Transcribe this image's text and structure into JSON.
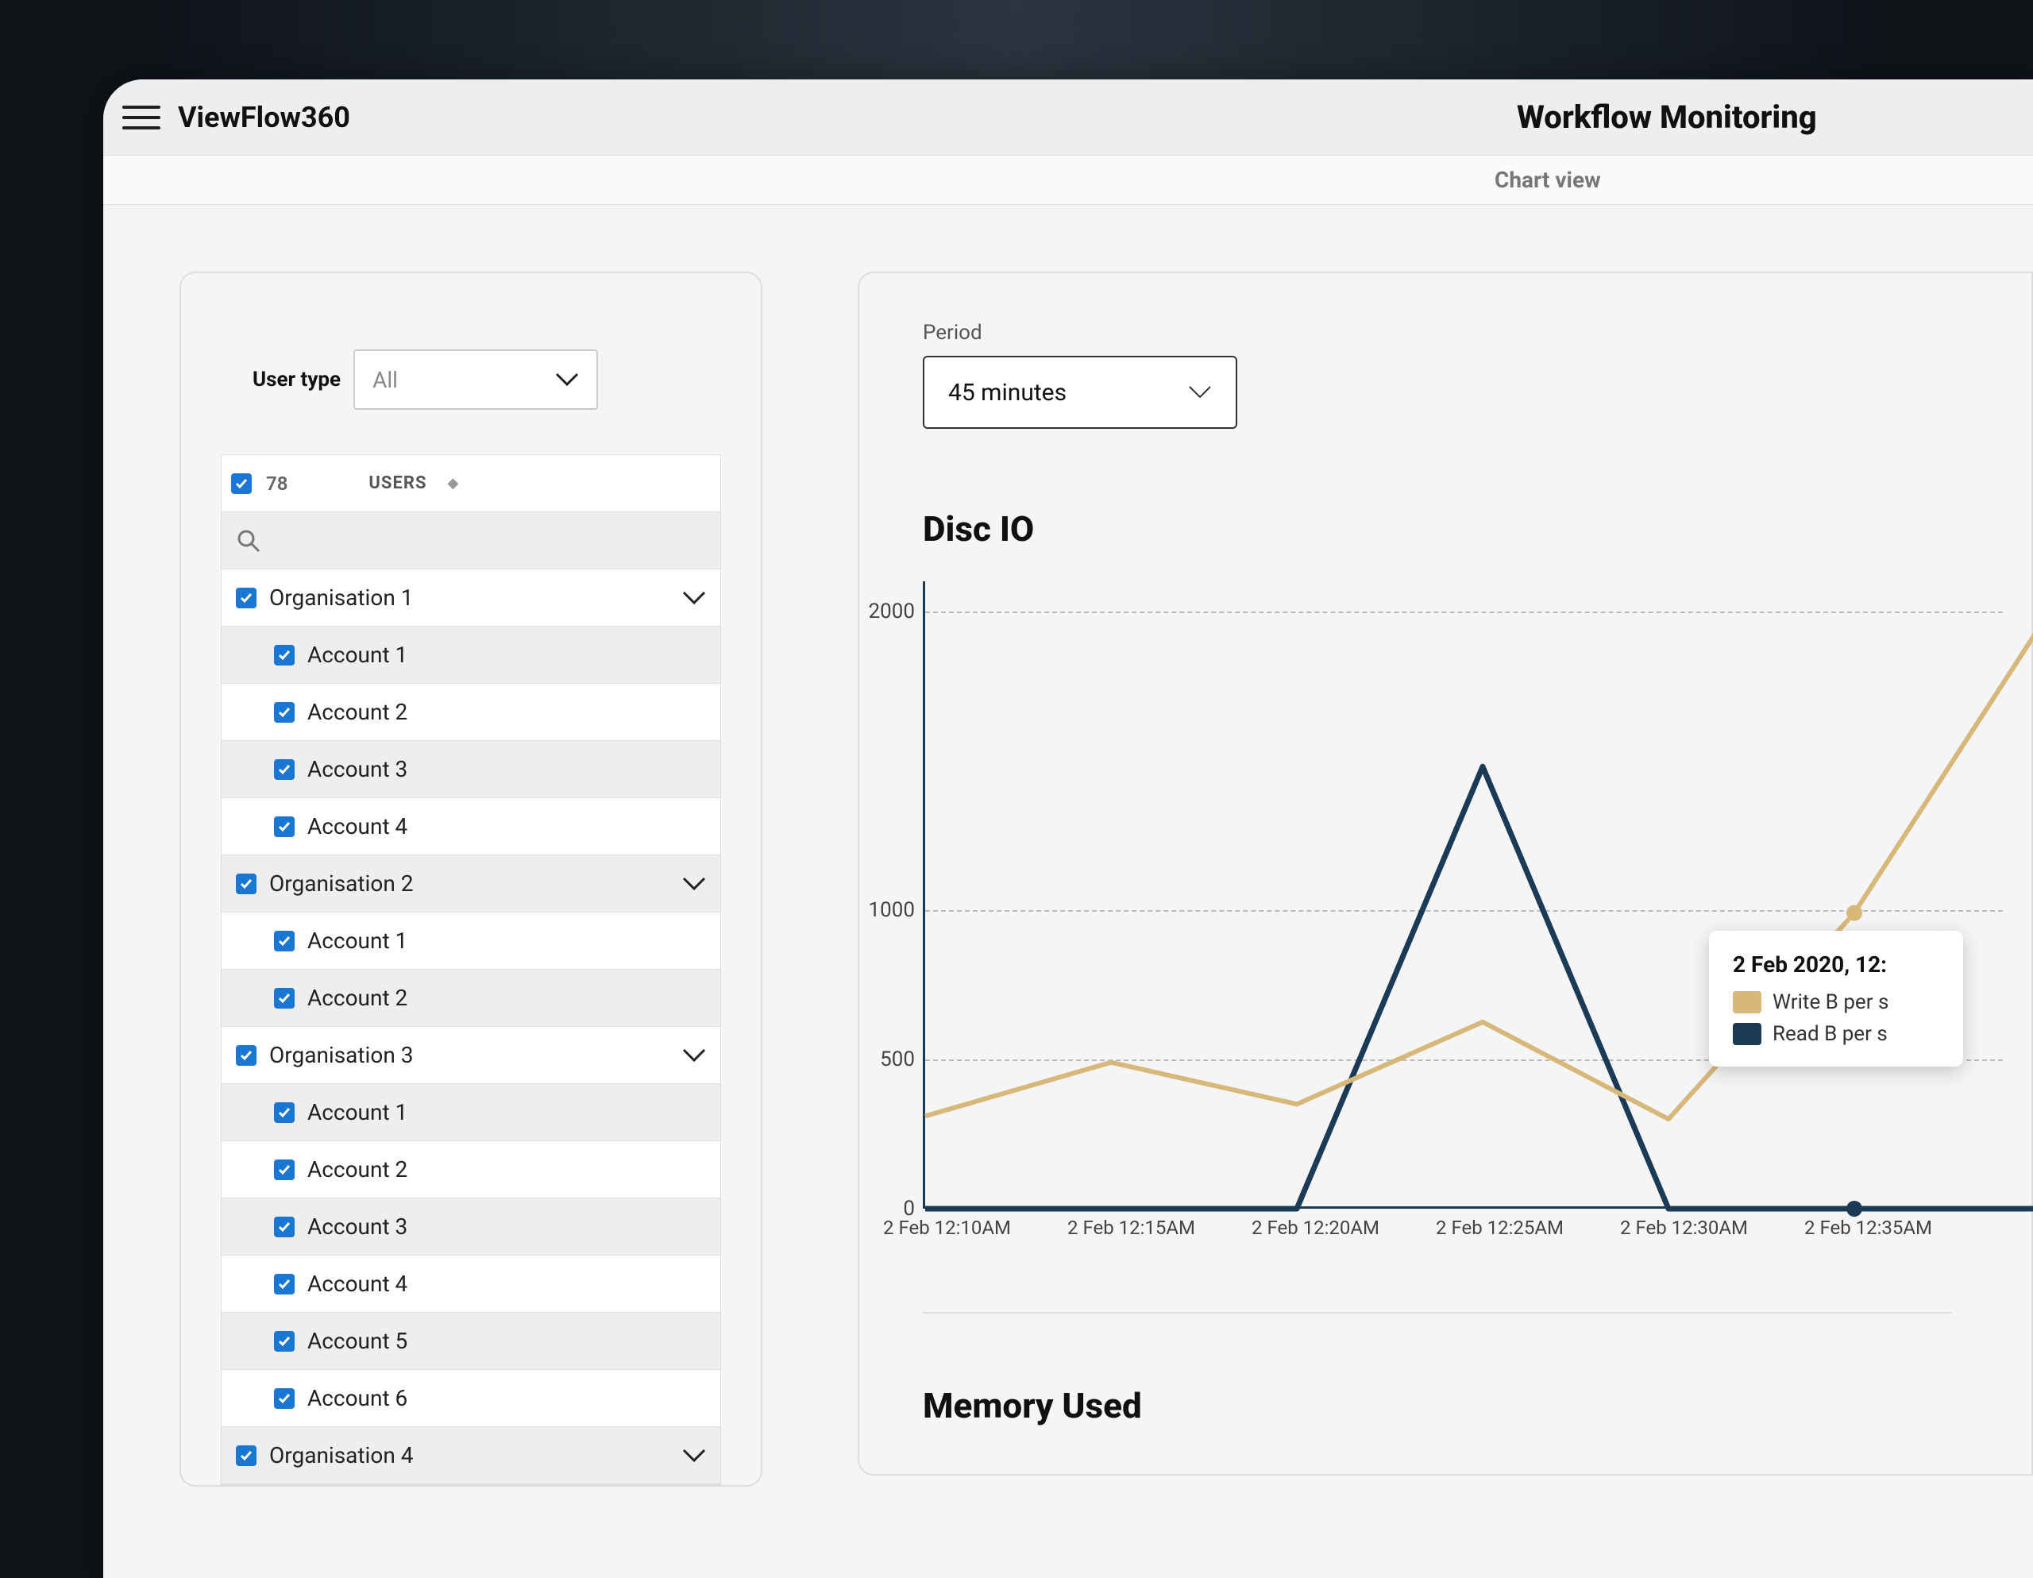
{
  "app": {
    "name": "ViewFlow360",
    "page_title": "Workflow Monitoring",
    "subbar": "Chart view"
  },
  "sidebar": {
    "user_type_label": "User type",
    "user_type_value": "All",
    "users_count": "78",
    "users_header": "USERS",
    "orgs": [
      {
        "label": "Organisation 1",
        "alt": false,
        "accounts": [
          {
            "label": "Account 1",
            "alt": true
          },
          {
            "label": "Account 2",
            "alt": false
          },
          {
            "label": "Account 3",
            "alt": true
          },
          {
            "label": "Account 4",
            "alt": false
          }
        ]
      },
      {
        "label": "Organisation 2",
        "alt": true,
        "accounts": [
          {
            "label": "Account 1",
            "alt": false
          },
          {
            "label": "Account 2",
            "alt": true
          }
        ]
      },
      {
        "label": "Organisation 3",
        "alt": false,
        "accounts": [
          {
            "label": "Account 1",
            "alt": true
          },
          {
            "label": "Account 2",
            "alt": false
          },
          {
            "label": "Account 3",
            "alt": true
          },
          {
            "label": "Account 4",
            "alt": false
          },
          {
            "label": "Account 5",
            "alt": true
          },
          {
            "label": "Account 6",
            "alt": false
          }
        ]
      },
      {
        "label": "Organisation 4",
        "alt": true,
        "accounts": []
      }
    ]
  },
  "period": {
    "label": "Period",
    "value": "45 minutes"
  },
  "chart_data": [
    {
      "type": "line",
      "title": "Disc IO",
      "xlabel": "",
      "ylabel": "",
      "ylim": [
        0,
        2100
      ],
      "x": [
        "2 Feb 12:10AM",
        "2 Feb 12:15AM",
        "2 Feb 12:20AM",
        "2 Feb 12:25AM",
        "2 Feb 12:30AM",
        "2 Feb 12:35AM"
      ],
      "y_ticks": [
        0,
        500,
        1000,
        2000
      ],
      "series": [
        {
          "name": "Write B per s",
          "color": "#d8b87a",
          "values": [
            310,
            490,
            350,
            625,
            300,
            990,
            1950
          ]
        },
        {
          "name": "Read B per s",
          "color": "#1a3a56",
          "values": [
            0,
            0,
            0,
            1480,
            0,
            0,
            0
          ]
        }
      ],
      "highlight": {
        "x_index": 4,
        "series_index": 1
      },
      "tooltip": {
        "title": "2 Feb 2020, 12:",
        "rows": [
          {
            "label": "Write B per s",
            "color": "#d8b87a"
          },
          {
            "label": "Read B per s",
            "color": "#1a3a56"
          }
        ]
      }
    },
    {
      "type": "line",
      "title": "Memory Used"
    }
  ]
}
